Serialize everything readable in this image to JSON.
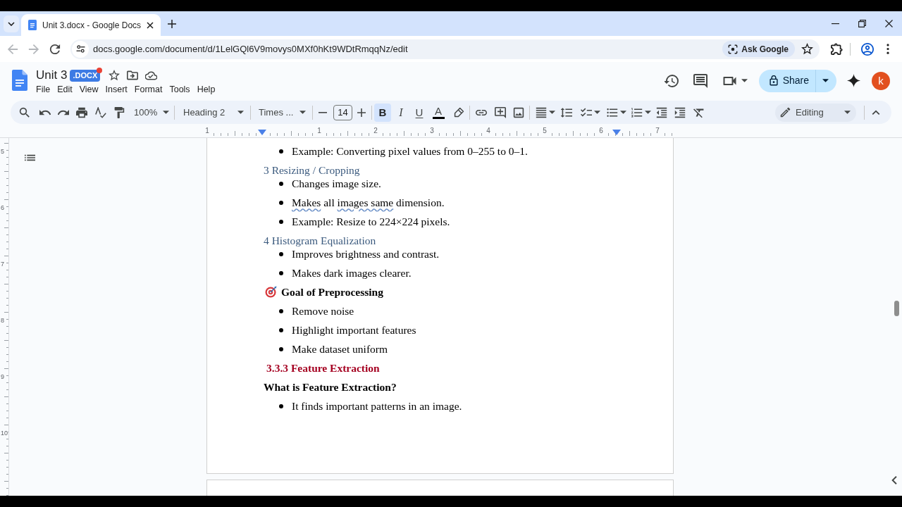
{
  "browser": {
    "tabs": [
      {
        "title": "Unit 3.docx - Google Docs",
        "selected": true
      }
    ],
    "back_disabled": true,
    "forward_disabled": true,
    "url": "docs.google.com/document/d/1LelGQl6V9movys0MXf0hKt9WDtRmqqNz/edit",
    "ask_button": "Ask Google"
  },
  "docs": {
    "title": "Unit 3",
    "badge": ".DOCX",
    "menus": [
      "File",
      "Edit",
      "View",
      "Insert",
      "Format",
      "Tools",
      "Help"
    ],
    "share": "Share",
    "avatar": "k"
  },
  "toolbar": {
    "zoom": "100%",
    "style": "Heading 2",
    "font": "Times ...",
    "font_size": "14",
    "format_toggles": [
      {
        "kind": "bold",
        "label": "B",
        "selected": true
      },
      {
        "kind": "italic",
        "label": "I",
        "selected": false
      },
      {
        "kind": "underline",
        "label": "U",
        "selected": false
      }
    ],
    "text_color": "A",
    "mode": "Editing"
  },
  "ruler": {
    "leading_label": "1",
    "labels": [
      "1",
      "2",
      "3",
      "4",
      "5",
      "6",
      "7"
    ]
  },
  "vertical_ruler": {
    "labels": [
      "5",
      "6",
      "7",
      "8",
      "9",
      "10"
    ]
  },
  "document": {
    "blocks": [
      {
        "kind": "bullet",
        "text": "Example: Converting pixel values from 0–255 to 0–1."
      },
      {
        "kind": "subheading",
        "text": "3 Resizing / Cropping"
      },
      {
        "kind": "bullet",
        "text": "Changes image size."
      },
      {
        "kind": "bullet",
        "segments": [
          {
            "text": "Makes",
            "flagged": true
          },
          {
            "text": " all ",
            "flagged": false
          },
          {
            "text": "images same",
            "flagged": true
          },
          {
            "text": " dimension.",
            "flagged": false
          }
        ]
      },
      {
        "kind": "bullet",
        "text": "Example: Resize to 224×224 pixels."
      },
      {
        "kind": "subheading",
        "text": "4 Histogram Equalization"
      },
      {
        "kind": "bullet",
        "text": "Improves brightness and contrast."
      },
      {
        "kind": "bullet",
        "text": "Makes dark images clearer."
      },
      {
        "kind": "emoji_heading",
        "text": "Goal of Preprocessing"
      },
      {
        "kind": "bullet",
        "text": "Remove noise"
      },
      {
        "kind": "bullet",
        "text": "Highlight important features"
      },
      {
        "kind": "bullet",
        "text": "Make dataset uniform"
      },
      {
        "kind": "section_heading",
        "text": "3.3.3 Feature Extraction"
      },
      {
        "kind": "question",
        "text": "What is Feature Extraction?"
      },
      {
        "kind": "bullet",
        "text": "It finds important patterns in an image."
      }
    ]
  }
}
